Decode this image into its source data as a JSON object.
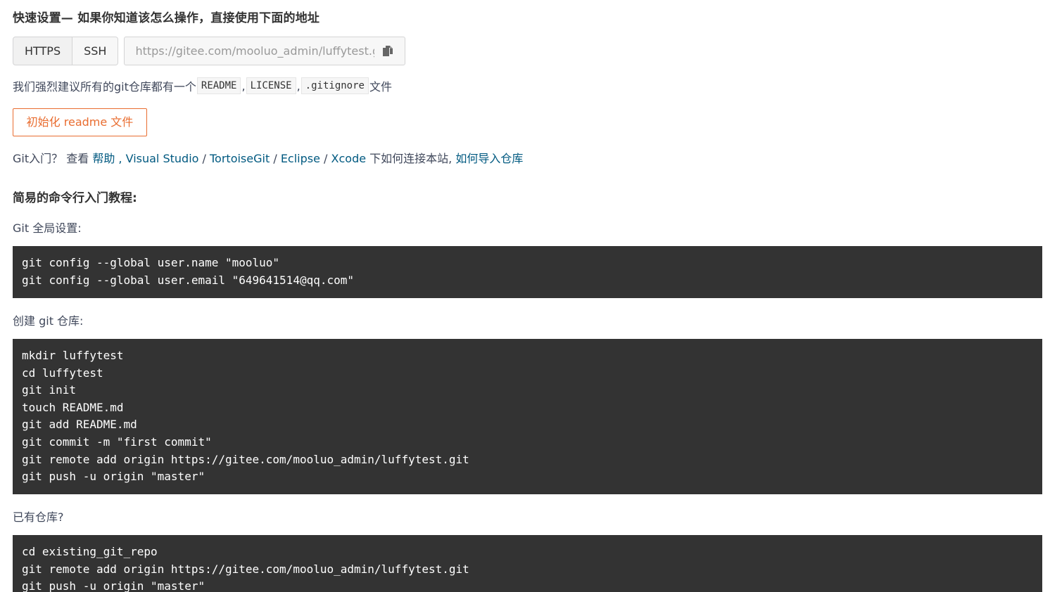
{
  "quick_setup": {
    "title": "快速设置— 如果你知道该怎么操作，直接使用下面的地址",
    "protocols": [
      "HTTPS",
      "SSH"
    ],
    "url": "https://gitee.com/mooluo_admin/luffytest.git"
  },
  "recommend": {
    "prefix": "我们强烈建议所有的git仓库都有一个",
    "files": [
      "README",
      "LICENSE",
      ".gitignore"
    ],
    "sep": ",",
    "suffix": "文件"
  },
  "init_button": "初始化 readme 文件",
  "help": {
    "prefix": "Git入门？ 查看",
    "help_link": "帮助",
    "comma": ",",
    "visual_studio": "Visual Studio",
    "slash": "/",
    "tortoise": "TortoiseGit",
    "eclipse": "Eclipse",
    "xcode": "Xcode",
    "connect_text": "下如何连接本站,",
    "import_link": "如何导入仓库"
  },
  "tutorial": {
    "title": "简易的命令行入门教程:",
    "global_label": "Git 全局设置:",
    "global_code": [
      "git config --global user.name \"mooluo\"",
      "git config --global user.email \"649641514@qq.com\""
    ],
    "create_label": "创建 git 仓库:",
    "create_code": [
      "mkdir luffytest",
      "cd luffytest",
      "git init",
      "touch README.md",
      "git add README.md",
      "git commit -m \"first commit\"",
      "git remote add origin https://gitee.com/mooluo_admin/luffytest.git",
      "git push -u origin \"master\""
    ],
    "existing_label": "已有仓库?",
    "existing_code": [
      "cd existing_git_repo",
      "git remote add origin https://gitee.com/mooluo_admin/luffytest.git",
      "git push -u origin \"master\""
    ]
  },
  "colors": {
    "accent": "#e96d30",
    "link": "#005980",
    "code_bg": "#333333"
  },
  "icons": {
    "copy": "copy-icon"
  }
}
